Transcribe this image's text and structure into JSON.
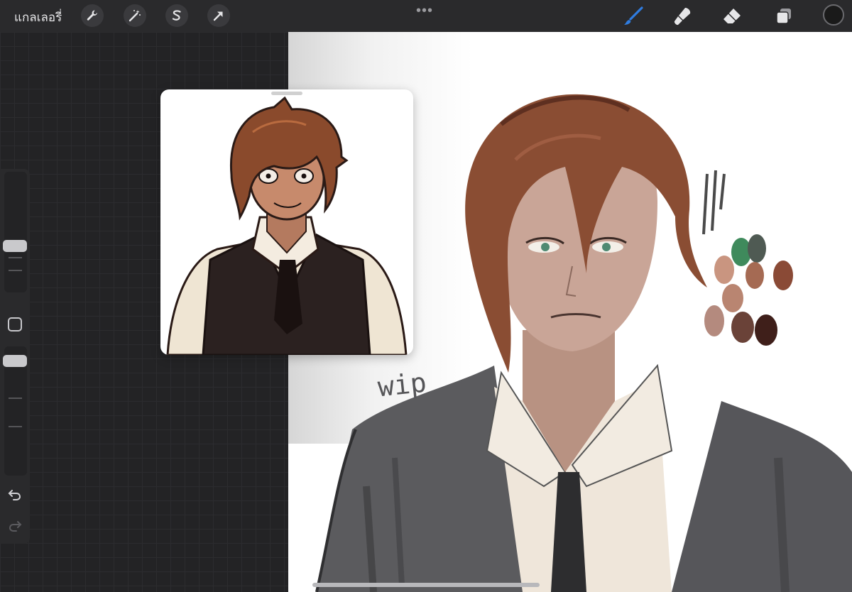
{
  "toolbar": {
    "gallery_label": "แกลเลอรี่",
    "left_tools": [
      "wrench-icon",
      "magic-wand-icon",
      "selection-s-icon",
      "arrow-transform-icon"
    ],
    "right_tools": [
      "brush-icon",
      "smudge-icon",
      "eraser-icon",
      "layers-icon"
    ],
    "active_tool": "brush-icon",
    "current_color": "#1a1a1a",
    "accent_color": "#2f7ce0"
  },
  "canvas": {
    "annotation_text": "wip"
  },
  "sidebar": {
    "controls": [
      "brush-size-slider",
      "modify-button",
      "opacity-slider",
      "undo-icon",
      "redo-icon"
    ]
  },
  "palette": [
    "#3f8a5c",
    "#4f5a53",
    "#c99580",
    "#a56a53",
    "#8a4a36",
    "#b98571",
    "#9b6a59",
    "#b48a7e",
    "#6a4238",
    "#3f1f1a"
  ]
}
